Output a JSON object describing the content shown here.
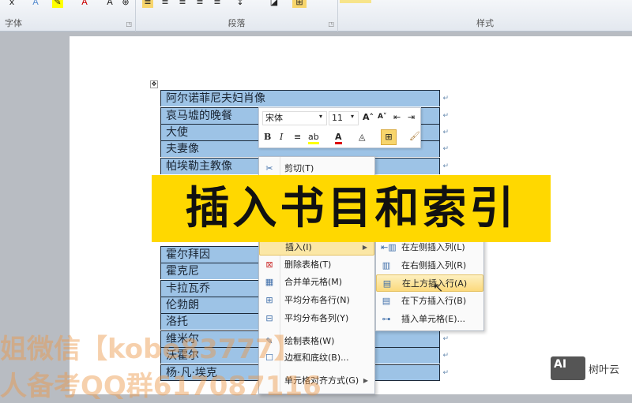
{
  "ribbon": {
    "groups": [
      {
        "label": "字体"
      },
      {
        "label": "段落"
      },
      {
        "label": "样式"
      }
    ]
  },
  "table": {
    "rows": [
      "阿尔诺菲尼夫妇肖像",
      "哀马墟的晚餐",
      "大使",
      "夫妻像",
      "帕埃勒主教像",
      "霍尔拜因",
      "霍克尼",
      "卡拉瓦乔",
      "伦勃朗",
      "洛托",
      "维米尔",
      "沃霍尔",
      "杨·凡·埃克"
    ]
  },
  "mini_toolbar": {
    "font": "宋体",
    "size": "11"
  },
  "context_menu": {
    "items": [
      {
        "label": "剪切(T)"
      },
      {
        "label": "插入(I)"
      },
      {
        "label": "删除表格(T)"
      },
      {
        "label": "合并单元格(M)"
      },
      {
        "label": "平均分布各行(N)"
      },
      {
        "label": "平均分布各列(Y)"
      },
      {
        "label": "绘制表格(W)"
      },
      {
        "label": "边框和底纹(B)..."
      },
      {
        "label": "单元格对齐方式(G)"
      }
    ]
  },
  "submenu": {
    "items": [
      {
        "label": "在左侧插入列(L)"
      },
      {
        "label": "在右侧插入列(R)"
      },
      {
        "label": "在上方插入行(A)"
      },
      {
        "label": "在下方插入行(B)"
      },
      {
        "label": "插入单元格(E)..."
      }
    ],
    "highlighted": "在上方插入行(A)"
  },
  "banner": {
    "title": "插入书目和索引"
  },
  "watermark": {
    "line1": "姐微信【kobe83777】",
    "line2": "人备考QQ群617087116"
  },
  "logo": {
    "icon_text": "AI",
    "name": "树叶云"
  }
}
